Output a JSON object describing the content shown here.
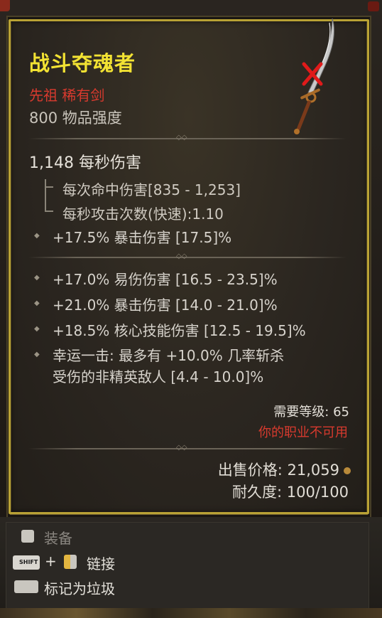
{
  "item": {
    "name": "战斗夺魂者",
    "rarity_type": "先祖 稀有剑",
    "item_power": "800 物品强度",
    "dps": "1,148 每秒伤害",
    "damage_per_hit": "每次命中伤害[835 - 1,253]",
    "attacks_per_second": "每秒攻击次数(快速):1.10",
    "implicit_affix": "+17.5% 暴击伤害 [17.5]%",
    "affixes": [
      "+17.0% 易伤伤害 [16.5 - 23.5]%",
      "+21.0% 暴击伤害 [14.0 - 21.0]%",
      "+18.5% 核心技能伤害 [12.5 - 19.5]%"
    ],
    "special_affix_line1": "幸运一击: 最多有 +10.0% 几率斩杀",
    "special_affix_line2": "受伤的非精英敌人 [4.4 - 10.0]%",
    "required_level": "需要等级: 65",
    "class_restriction": "你的职业不可用",
    "sell_price": "出售价格: 21,059",
    "durability": "耐久度: 100/100"
  },
  "actions": {
    "equip": "装备",
    "link_modifier": "+",
    "link": "链接",
    "mark_junk": "标记为垃圾",
    "shift_key": "SHIFT"
  },
  "colors": {
    "title": "#f2e233",
    "rarity": "#d83a2e",
    "border": "#b9a235"
  },
  "icons": {
    "weapon": "sword-icon",
    "unusable": "red-x-icon",
    "coin": "gold-coin-icon"
  }
}
